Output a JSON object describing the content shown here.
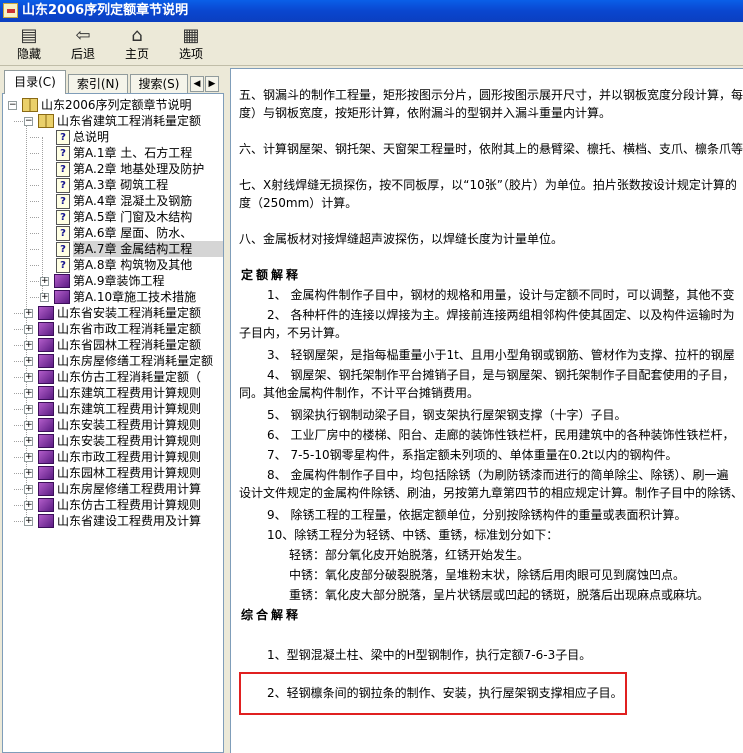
{
  "window": {
    "title": "山东2006序列定额章节说明"
  },
  "toolbar": {
    "buttons": [
      {
        "label": "隐藏",
        "icon": "hide-icon"
      },
      {
        "label": "后退",
        "icon": "back-arrow-icon"
      },
      {
        "label": "主页",
        "icon": "home-icon"
      },
      {
        "label": "选项",
        "icon": "options-icon"
      }
    ]
  },
  "tabs": [
    {
      "label": "目录(C)",
      "active": true
    },
    {
      "label": "索引(N)",
      "active": false
    },
    {
      "label": "搜索(S)",
      "active": false
    }
  ],
  "tree": [
    {
      "label": "山东2006序列定额章节说明",
      "icon": "open-book-icon",
      "expanded": true
    },
    {
      "label": "山东省建筑工程消耗量定额",
      "icon": "open-book-icon",
      "expanded": true
    },
    {
      "label": "总说明",
      "icon": "help-page-icon"
    },
    {
      "label": "第A.1章 土、石方工程",
      "icon": "help-page-icon"
    },
    {
      "label": "第A.2章 地基处理及防护",
      "icon": "help-page-icon"
    },
    {
      "label": "第A.3章 砌筑工程",
      "icon": "help-page-icon"
    },
    {
      "label": "第A.4章 混凝土及钢筋",
      "icon": "help-page-icon"
    },
    {
      "label": "第A.5章 门窗及木结构",
      "icon": "help-page-icon"
    },
    {
      "label": "第A.6章 屋面、防水、",
      "icon": "help-page-icon"
    },
    {
      "label": "第A.7章 金属结构工程",
      "icon": "help-page-icon",
      "selected": true
    },
    {
      "label": "第A.8章 构筑物及其他",
      "icon": "help-page-icon"
    },
    {
      "label": "第A.9章装饰工程",
      "icon": "closed-book-icon",
      "expanded": false
    },
    {
      "label": "第A.10章施工技术措施",
      "icon": "closed-book-icon",
      "expanded": false
    },
    {
      "label": "山东省安装工程消耗量定额",
      "icon": "closed-book-icon",
      "expanded": false
    },
    {
      "label": "山东省市政工程消耗量定额",
      "icon": "closed-book-icon",
      "expanded": false
    },
    {
      "label": "山东省园林工程消耗量定额",
      "icon": "closed-book-icon",
      "expanded": false
    },
    {
      "label": "山东房屋修缮工程消耗量定额",
      "icon": "closed-book-icon",
      "expanded": false
    },
    {
      "label": "山东仿古工程消耗量定额（",
      "icon": "closed-book-icon",
      "expanded": false
    },
    {
      "label": "山东建筑工程费用计算规则",
      "icon": "closed-book-icon",
      "expanded": false
    },
    {
      "label": "山东建筑工程费用计算规则",
      "icon": "closed-book-icon",
      "expanded": false
    },
    {
      "label": "山东安装工程费用计算规则",
      "icon": "closed-book-icon",
      "expanded": false
    },
    {
      "label": "山东安装工程费用计算规则",
      "icon": "closed-book-icon",
      "expanded": false
    },
    {
      "label": "山东市政工程费用计算规则",
      "icon": "closed-book-icon",
      "expanded": false
    },
    {
      "label": "山东园林工程费用计算规则",
      "icon": "closed-book-icon",
      "expanded": false
    },
    {
      "label": "山东房屋修缮工程费用计算",
      "icon": "closed-book-icon",
      "expanded": false
    },
    {
      "label": "山东仿古工程费用计算规则",
      "icon": "closed-book-icon",
      "expanded": false
    },
    {
      "label": "山东省建设工程费用及计算",
      "icon": "closed-book-icon",
      "expanded": false
    }
  ],
  "content": {
    "lines": [
      {
        "text": "五、钢漏斗的制作工程量，矩形按图示分片，圆形按图示展开尺寸，并以钢板宽度分段计算，每段",
        "style": "normal"
      },
      {
        "text": "度）与钢板宽度，按矩形计算，依附漏斗的型钢并入漏斗重量内计算。",
        "style": "normal"
      },
      {
        "text": "六、计算钢屋架、钢托架、天窗架工程量时，依附其上的悬臂梁、檩托、横档、支爪、檩条爪等",
        "style": "normal"
      },
      {
        "text": "七、X射线焊缝无损探伤，按不同板厚，以“10张”（胶片）为单位。拍片张数按设计规定计算的",
        "style": "normal"
      },
      {
        "text": "度（250mm）计算。",
        "style": "normal"
      },
      {
        "text": "八、金属板材对接焊缝超声波探伤，以焊缝长度为计量单位。",
        "style": "normal"
      },
      {
        "text": "定额解释",
        "style": "heading"
      },
      {
        "text": "1、     金属构件制作子目中，钢材的规格和用量，设计与定额不同时，可以调整，其他不变",
        "style": "normal"
      },
      {
        "text": "2、     各种杆件的连接以焊接为主。焊接前连接两组相邻构件使其固定、以及构件运输时为",
        "style": "normal"
      },
      {
        "text": "子目内，不另计算。",
        "style": "normal"
      },
      {
        "text": "3、     轻钢屋架，是指每榀重量小于1t、且用小型角钢或钢筋、管材作为支撑、拉杆的钢屋",
        "style": "normal"
      },
      {
        "text": "4、     钢屋架、钢托架制作平台摊销子目，是与钢屋架、钢托架制作子目配套使用的子目，",
        "style": "normal"
      },
      {
        "text": "同。其他金属构件制作，不计平台摊销费用。",
        "style": "normal"
      },
      {
        "text": "5、     钢梁执行钢制动梁子目，钢支架执行屋架钢支撑（十字）子目。",
        "style": "normal"
      },
      {
        "text": "6、     工业厂房中的楼梯、阳台、走廊的装饰性铁栏杆，民用建筑中的各种装饰性铁栏杆，",
        "style": "normal"
      },
      {
        "text": "7、     7-5-10钢零星构件，系指定额未列项的、单体重量在0.2t以内的钢构件。",
        "style": "normal"
      },
      {
        "text": "8、     金属构件制作子目中，均包括除锈（为刷防锈漆而进行的简单除尘、除锈）、刷一遍",
        "style": "normal"
      },
      {
        "text": "设计文件规定的金属构件除锈、刷油，另按第九章第四节的相应规定计算。制作子目中的除锈、",
        "style": "normal"
      },
      {
        "text": "9、     除锈工程的工程量，依据定额单位，分别按除锈构件的重量或表面积计算。",
        "style": "normal"
      },
      {
        "text": "10、除锈工程分为轻锈、中锈、重锈，标准划分如下：",
        "style": "normal"
      },
      {
        "text": "轻锈：部分氧化皮开始脱落，红锈开始发生。",
        "style": "normal"
      },
      {
        "text": "中锈：氧化皮部分破裂脱落，呈堆粉末状，除锈后用肉眼可见到腐蚀凹点。",
        "style": "normal"
      },
      {
        "text": "重锈：氧化皮大部分脱落，呈片状锈层或凹起的锈斑，脱落后出现麻点或麻坑。",
        "style": "normal"
      },
      {
        "text": "综合解释",
        "style": "heading"
      },
      {
        "text": "1、型钢混凝土柱、梁中的H型钢制作，执行定额7-6-3子目。",
        "style": "normal"
      },
      {
        "text": "2、轻钢檩条间的钢拉条的制作、安装，执行屋架钢支撑相应子目。",
        "style": "highlighted"
      }
    ]
  }
}
